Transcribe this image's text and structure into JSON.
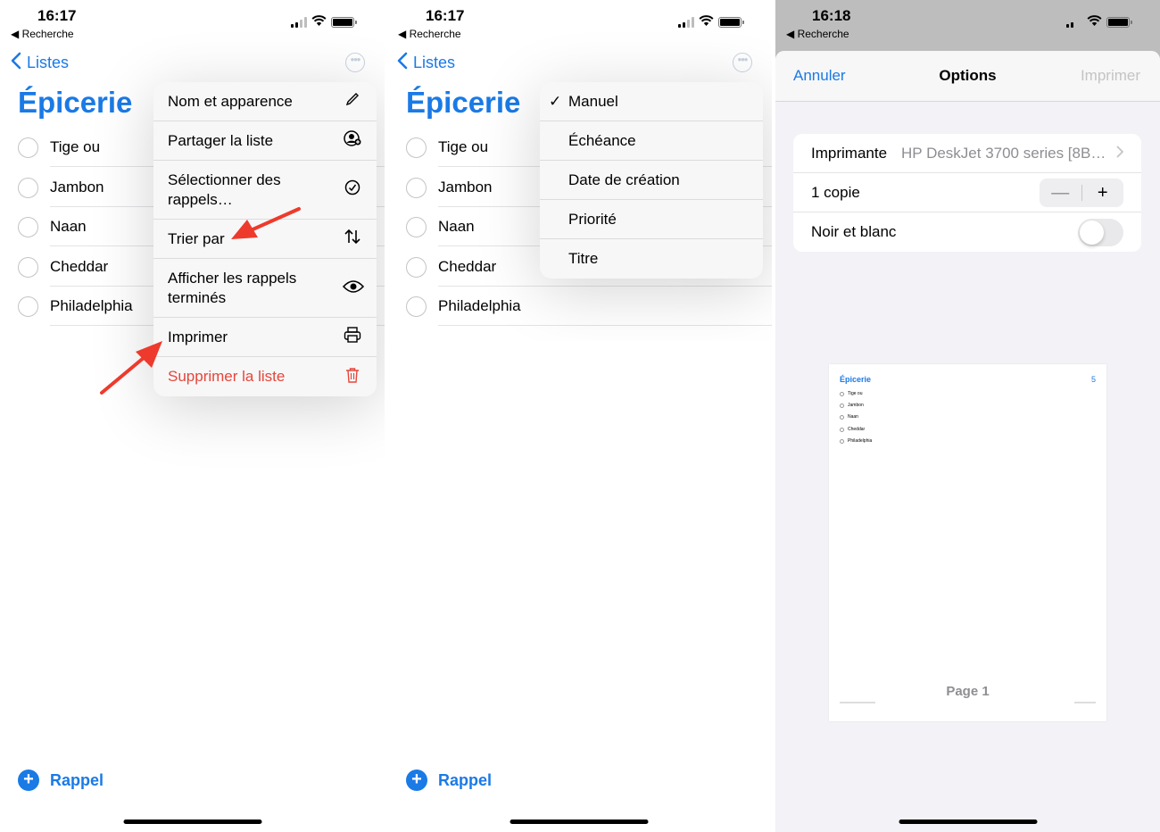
{
  "panel1": {
    "status": {
      "time": "16:17",
      "back": "◀ Recherche"
    },
    "nav": {
      "back_label": "Listes"
    },
    "list": {
      "title": "Épicerie",
      "items": [
        "Tige ou",
        "Jambon",
        "Naan",
        "Cheddar",
        "Philadelphia"
      ]
    },
    "menu": [
      {
        "label": "Nom et apparence",
        "icon": "pencil-icon"
      },
      {
        "label": "Partager la liste",
        "icon": "share-person-icon"
      },
      {
        "label": "Sélectionner des rappels…",
        "icon": "checkmark-circle-icon"
      },
      {
        "label": "Trier par",
        "icon": "sort-arrows-icon"
      },
      {
        "label": "Afficher les rappels terminés",
        "icon": "eye-icon"
      },
      {
        "label": "Imprimer",
        "icon": "printer-icon"
      },
      {
        "label": "Supprimer la liste",
        "icon": "trash-icon"
      }
    ],
    "add_label": "Rappel"
  },
  "panel2": {
    "status": {
      "time": "16:17",
      "back": "◀ Recherche"
    },
    "nav": {
      "back_label": "Listes"
    },
    "list": {
      "title": "Épicerie",
      "items": [
        "Tige ou",
        "Jambon",
        "Naan",
        "Cheddar",
        "Philadelphia"
      ]
    },
    "sort_menu": [
      "Manuel",
      "Échéance",
      "Date de création",
      "Priorité",
      "Titre"
    ],
    "sort_selected": "Manuel",
    "add_label": "Rappel"
  },
  "panel3": {
    "status": {
      "time": "16:18",
      "back": "◀ Recherche"
    },
    "header": {
      "cancel": "Annuler",
      "title": "Options",
      "print": "Imprimer"
    },
    "options": {
      "printer_label": "Imprimante",
      "printer_value": "HP DeskJet 3700 series [8B…",
      "copies_label": "1 copie",
      "stepper_minus": "—",
      "stepper_plus": "+",
      "bw_label": "Noir et blanc",
      "bw_on": false
    },
    "preview": {
      "title": "Épicerie",
      "count": "5",
      "items": [
        "Tige ou",
        "Jambon",
        "Naan",
        "Cheddar",
        "Philadelphia"
      ],
      "page_label": "Page 1"
    }
  },
  "colors": {
    "accent": "#1a7ae6",
    "danger": "#e5463b",
    "arrow": "#ee3a2c"
  }
}
